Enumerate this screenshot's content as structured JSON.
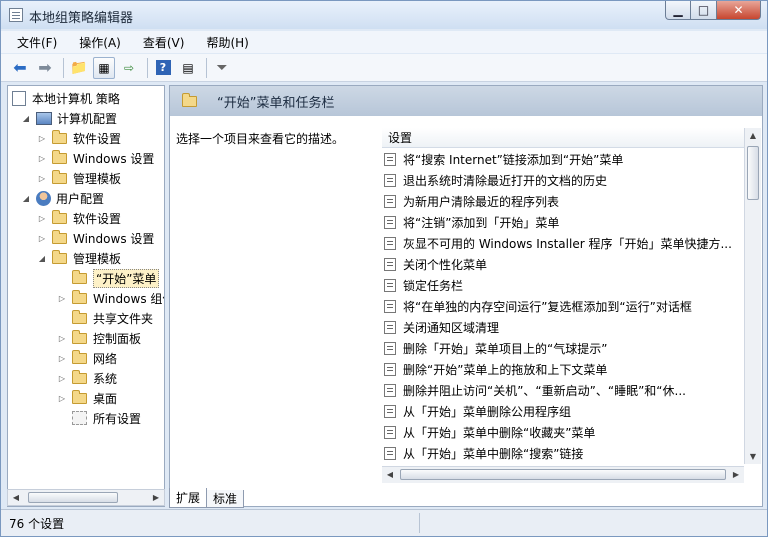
{
  "window": {
    "title": "本地组策略编辑器"
  },
  "menu": [
    "文件(F)",
    "操作(A)",
    "查看(V)",
    "帮助(H)"
  ],
  "toolbar_icons": [
    "back-icon",
    "forward-icon",
    "up-folder-icon",
    "show-hide-tree-icon",
    "export-list-icon",
    "help-icon",
    "properties-icon",
    "filter-icon"
  ],
  "tree": [
    {
      "label": "本地计算机 策略",
      "icon": "policy-icon",
      "level": 0,
      "toggle": ""
    },
    {
      "label": "计算机配置",
      "icon": "computer-icon",
      "level": 1,
      "toggle": "open"
    },
    {
      "label": "软件设置",
      "icon": "folder-icon",
      "level": 2,
      "toggle": "closed"
    },
    {
      "label": "Windows 设置",
      "icon": "folder-icon",
      "level": 2,
      "toggle": "closed"
    },
    {
      "label": "管理模板",
      "icon": "folder-icon",
      "level": 2,
      "toggle": "closed"
    },
    {
      "label": "用户配置",
      "icon": "user-icon",
      "level": 1,
      "toggle": "open"
    },
    {
      "label": "软件设置",
      "icon": "folder-icon",
      "level": 2,
      "toggle": "closed"
    },
    {
      "label": "Windows 设置",
      "icon": "folder-icon",
      "level": 2,
      "toggle": "closed"
    },
    {
      "label": "管理模板",
      "icon": "folder-icon",
      "level": 2,
      "toggle": "open"
    },
    {
      "label": "“开始”菜单",
      "icon": "folder-icon",
      "level": 3,
      "toggle": "",
      "selected": true
    },
    {
      "label": "Windows 组件",
      "icon": "folder-icon",
      "level": 3,
      "toggle": "closed"
    },
    {
      "label": "共享文件夹",
      "icon": "folder-icon",
      "level": 3,
      "toggle": ""
    },
    {
      "label": "控制面板",
      "icon": "folder-icon",
      "level": 3,
      "toggle": "closed"
    },
    {
      "label": "网络",
      "icon": "folder-icon",
      "level": 3,
      "toggle": "closed"
    },
    {
      "label": "系统",
      "icon": "folder-icon",
      "level": 3,
      "toggle": "closed"
    },
    {
      "label": "桌面",
      "icon": "folder-icon",
      "level": 3,
      "toggle": "closed"
    },
    {
      "label": "所有设置",
      "icon": "settings-icon",
      "level": 3,
      "toggle": ""
    }
  ],
  "right": {
    "header": "“开始”菜单和任务栏",
    "description": "选择一个项目来查看它的描述。",
    "settings_header": "设置",
    "settings": [
      "将“搜索 Internet”链接添加到“开始”菜单",
      "退出系统时清除最近打开的文档的历史",
      "为新用户清除最近的程序列表",
      "将“注销”添加到「开始」菜单",
      "灰显不可用的 Windows Installer 程序「开始」菜单快捷方...",
      "关闭个性化菜单",
      "锁定任务栏",
      "将“在单独的内存空间运行”复选框添加到“运行”对话框",
      "关闭通知区域清理",
      "删除「开始」菜单项目上的“气球提示”",
      "删除“开始”菜单上的拖放和上下文菜单",
      "删除并阻止访问“关机”、“重新启动”、“睡眠”和“休...",
      "从「开始」菜单删除公用程序组",
      "从「开始」菜单中删除“收藏夹”菜单",
      "从「开始」菜单中删除“搜索”链接"
    ]
  },
  "tabs": [
    "扩展",
    "标准"
  ],
  "status": {
    "text": "76 个设置"
  }
}
